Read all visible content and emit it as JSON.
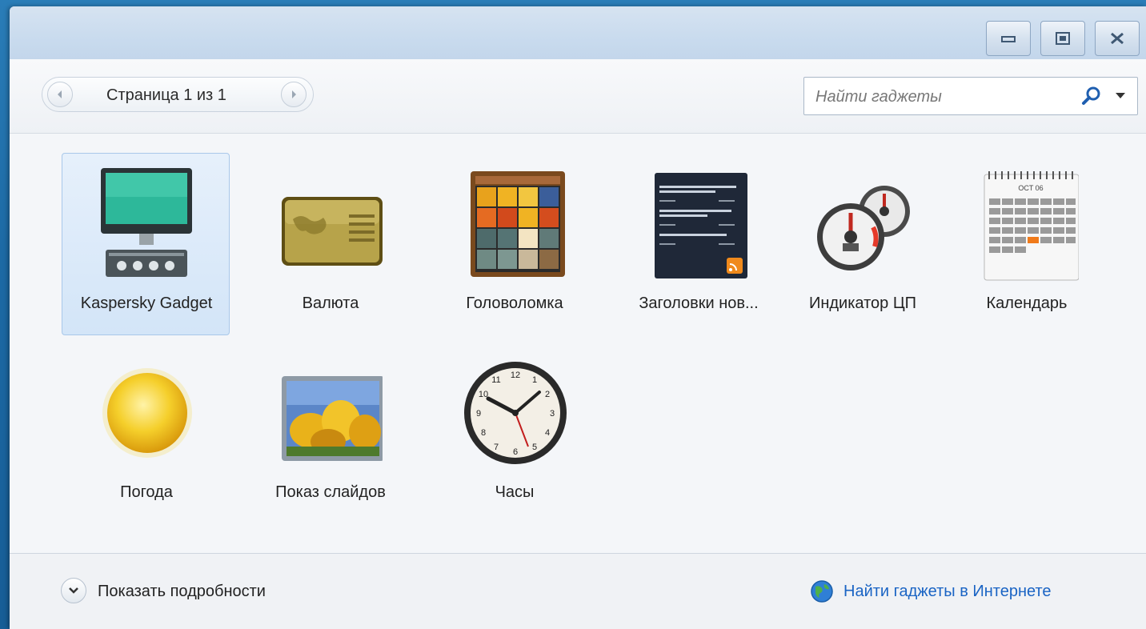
{
  "window": {
    "controls": [
      "minimize-icon",
      "maximize-icon",
      "close-icon"
    ]
  },
  "toolbar": {
    "page_label": "Страница 1 из 1",
    "search_placeholder": "Найти гаджеты"
  },
  "gadgets": [
    {
      "label": "Kaspersky Gadget",
      "icon": "kaspersky-monitor-icon",
      "selected": true
    },
    {
      "label": "Валюта",
      "icon": "currency-card-icon",
      "selected": false
    },
    {
      "label": "Головоломка",
      "icon": "puzzle-icon",
      "selected": false
    },
    {
      "label": "Заголовки нов...",
      "icon": "news-feed-icon",
      "selected": false
    },
    {
      "label": "Индикатор ЦП",
      "icon": "cpu-meter-icon",
      "selected": false
    },
    {
      "label": "Календарь",
      "icon": "calendar-icon",
      "selected": false
    },
    {
      "label": "Погода",
      "icon": "weather-sun-icon",
      "selected": false
    },
    {
      "label": "Показ слайдов",
      "icon": "slideshow-icon",
      "selected": false
    },
    {
      "label": "Часы",
      "icon": "clock-icon",
      "selected": false
    }
  ],
  "calendar_icon": {
    "month": "OCT 06"
  },
  "footer": {
    "details_label": "Показать подробности",
    "online_link": "Найти гаджеты в Интернете"
  },
  "colors": {
    "link": "#1a64c4",
    "selection": "#d3e5f8",
    "desktop": "#1d6aa5"
  }
}
